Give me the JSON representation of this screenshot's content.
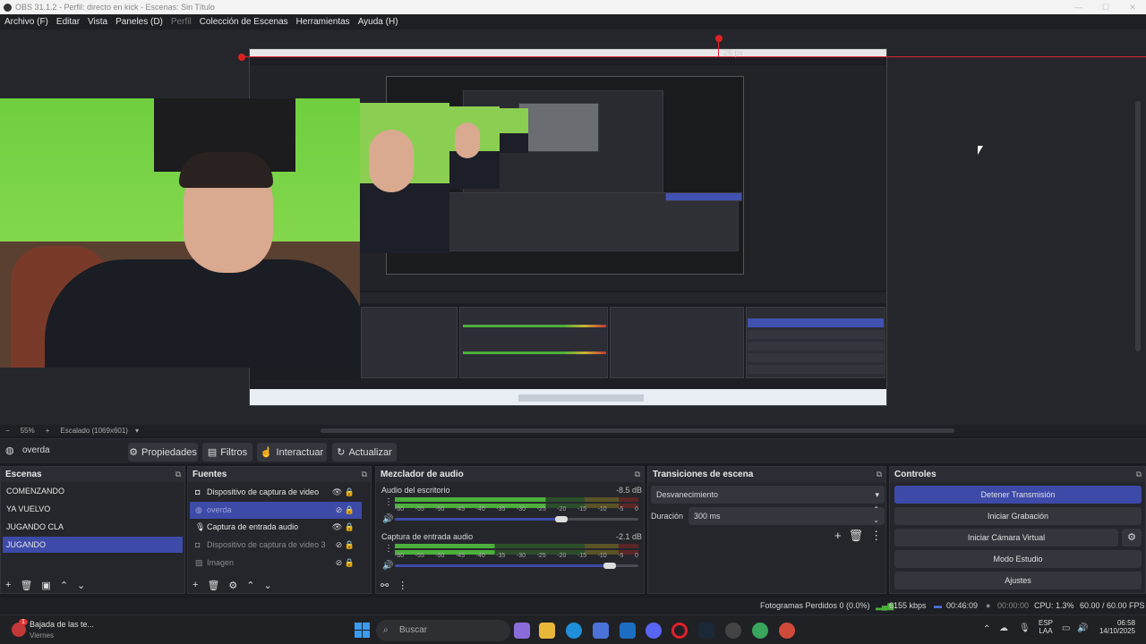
{
  "window": {
    "title": "OBS 31.1.2 - Perfil: directo en kick - Escenas: Sin Título"
  },
  "menu": [
    "Archivo (F)",
    "Editar",
    "Vista",
    "Paneles (D)",
    "Perfil",
    "Colección de Escenas",
    "Herramientas",
    "Ayuda (H)"
  ],
  "preview": {
    "resize_readout": "26 px"
  },
  "scalebar": {
    "zoom": "55%",
    "scaling": "Escalado (1069x601)"
  },
  "source_toolbar": {
    "selected_source": "overda",
    "buttons": [
      "Propiedades",
      "Filtros",
      "Interactuar",
      "Actualizar"
    ]
  },
  "docks": {
    "scenes": {
      "title": "Escenas",
      "items": [
        {
          "label": "COMENZANDO",
          "selected": false
        },
        {
          "label": "YA VUELVO",
          "selected": false
        },
        {
          "label": "JUGANDO CLA",
          "selected": false
        },
        {
          "label": "JUGANDO",
          "selected": true
        }
      ]
    },
    "sources": {
      "title": "Fuentes",
      "items": [
        {
          "label": "Dispositivo de captura de video",
          "icon": "camera-icon",
          "visible": true,
          "locked": true,
          "selected": false
        },
        {
          "label": "overda",
          "icon": "globe-icon",
          "visible": false,
          "locked": true,
          "selected": true
        },
        {
          "label": "Captura de entrada audio",
          "icon": "microphone-icon",
          "visible": true,
          "locked": true,
          "selected": false
        },
        {
          "label": "Dispositivo de captura de video 3",
          "icon": "camera-icon",
          "visible": false,
          "locked": true,
          "selected": false
        },
        {
          "label": "Imagen",
          "icon": "image-icon",
          "visible": false,
          "locked": true,
          "selected": false
        }
      ]
    },
    "mixer": {
      "title": "Mezclador de audio",
      "channels": [
        {
          "name": "Audio del escritorio",
          "db": "-8.5 dB",
          "level": 0.62,
          "volume": 0.83
        },
        {
          "name": "Captura de entrada audio",
          "db": "-2.1 dB",
          "level": 0.41,
          "volume": 0.98
        }
      ],
      "scale": [
        "-60",
        "-55",
        "-50",
        "-45",
        "-40",
        "-35",
        "-30",
        "-25",
        "-20",
        "-15",
        "-10",
        "-5",
        "0"
      ]
    },
    "transitions": {
      "title": "Transiciones de escena",
      "selected": "Desvanecimiento",
      "duration_label": "Duración",
      "duration_value": "300 ms"
    },
    "controls": {
      "title": "Controles",
      "buttons": [
        "Detener Transmisión",
        "Iniciar Grabación",
        "Iniciar Cámara Virtual",
        "Modo Estudio",
        "Ajustes"
      ]
    }
  },
  "statusbar": {
    "dropped": "Fotogramas Perdidos 0 (0.0%)",
    "bitrate": "6155 kbps",
    "stream_time": "00:46:09",
    "rec_time": "00:00:00",
    "cpu": "CPU: 1.3%",
    "fps": "60.00 / 60.00 FPS"
  },
  "taskbar": {
    "notification": {
      "title": "Bajada de las te...",
      "subtitle": "Viernes",
      "badge": "1"
    },
    "search": "Buscar",
    "lang": "ESP",
    "lang_sub": "LAA",
    "time": "06:58",
    "date": "14/10/2025"
  },
  "colors": {
    "accent": "#3d4aa8",
    "background": "#25262c",
    "meter_green": "#4caf3c",
    "meter_yellow": "#c9b234",
    "meter_red": "#c23838"
  }
}
